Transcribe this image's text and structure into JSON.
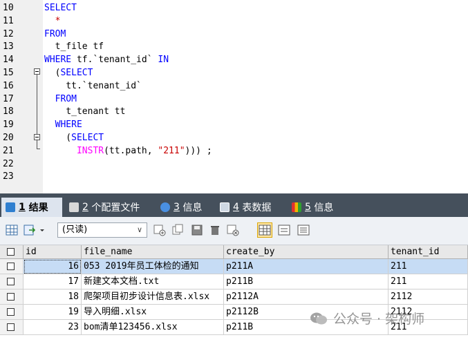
{
  "editor": {
    "lines": [
      {
        "n": "10",
        "tokens": [
          {
            "t": "SELECT",
            "c": "kw"
          }
        ]
      },
      {
        "n": "11",
        "tokens": [
          {
            "t": "  *",
            "c": "str"
          }
        ]
      },
      {
        "n": "12",
        "tokens": [
          {
            "t": "FROM",
            "c": "kw"
          }
        ]
      },
      {
        "n": "13",
        "tokens": [
          {
            "t": "  t_file tf",
            "c": "pun"
          }
        ]
      },
      {
        "n": "14",
        "tokens": [
          {
            "t": "WHERE",
            "c": "kw"
          },
          {
            "t": " tf.`tenant_id` ",
            "c": "pun"
          },
          {
            "t": "IN",
            "c": "kw"
          }
        ]
      },
      {
        "n": "15",
        "tokens": [
          {
            "t": "  (",
            "c": "pun"
          },
          {
            "t": "SELECT",
            "c": "kw"
          }
        ]
      },
      {
        "n": "16",
        "tokens": [
          {
            "t": "    tt.`tenant_id`",
            "c": "pun"
          }
        ]
      },
      {
        "n": "17",
        "tokens": [
          {
            "t": "  ",
            "c": "pun"
          },
          {
            "t": "FROM",
            "c": "kw"
          }
        ]
      },
      {
        "n": "18",
        "tokens": [
          {
            "t": "    t_tenant tt",
            "c": "pun"
          }
        ]
      },
      {
        "n": "19",
        "tokens": [
          {
            "t": "  ",
            "c": "pun"
          },
          {
            "t": "WHERE",
            "c": "kw"
          }
        ]
      },
      {
        "n": "20",
        "tokens": [
          {
            "t": "    (",
            "c": "pun"
          },
          {
            "t": "SELECT",
            "c": "kw"
          }
        ]
      },
      {
        "n": "21",
        "tokens": [
          {
            "t": "      ",
            "c": "pun"
          },
          {
            "t": "INSTR",
            "c": "fn"
          },
          {
            "t": "(tt.path, ",
            "c": "pun"
          },
          {
            "t": "\"211\"",
            "c": "str"
          },
          {
            "t": "))) ;",
            "c": "pun"
          }
        ]
      },
      {
        "n": "22",
        "tokens": []
      },
      {
        "n": "23",
        "tokens": []
      }
    ]
  },
  "tabs": [
    {
      "num": "1",
      "label": "结果",
      "active": true,
      "icon": "result-grid-icon",
      "color": "#2f7fd0"
    },
    {
      "num": "2",
      "label": "个配置文件",
      "active": false,
      "icon": "profile-icon",
      "color": "#d8d8d8"
    },
    {
      "num": "3",
      "label": "信息",
      "active": false,
      "icon": "info-icon",
      "color": "#4a90e2"
    },
    {
      "num": "4",
      "label": "表数据",
      "active": false,
      "icon": "table-data-icon",
      "color": "#cfd8e3"
    },
    {
      "num": "5",
      "label": "信息",
      "active": false,
      "icon": "info-bar-icon",
      "color": "#f0b400"
    }
  ],
  "toolbar": {
    "mode_select": "(只读)"
  },
  "grid": {
    "columns": [
      "id",
      "file_name",
      "create_by",
      "tenant_id"
    ],
    "rows": [
      {
        "id": "16",
        "file_name": "053 2019年员工体检的通知",
        "create_by": "p211A",
        "tenant_id": "211",
        "selected": true
      },
      {
        "id": "17",
        "file_name": "新建文本文档.txt",
        "create_by": "p211B",
        "tenant_id": "211",
        "selected": false
      },
      {
        "id": "18",
        "file_name": "爬架项目初步设计信息表.xlsx",
        "create_by": "p2112A",
        "tenant_id": "2112",
        "selected": false
      },
      {
        "id": "19",
        "file_name": "导入明细.xlsx",
        "create_by": "p2112B",
        "tenant_id": "2112",
        "selected": false
      },
      {
        "id": "23",
        "file_name": "bom清单123456.xlsx",
        "create_by": "p211B",
        "tenant_id": "211",
        "selected": false
      }
    ]
  },
  "watermark": "公众号 · 架构师"
}
